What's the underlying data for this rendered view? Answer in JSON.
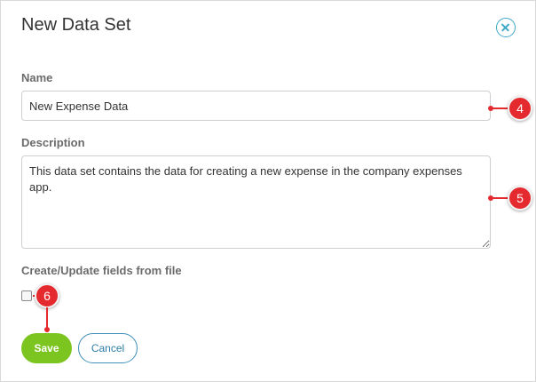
{
  "dialog": {
    "title": "New Data Set",
    "close_icon": "close-circle-icon"
  },
  "form": {
    "name_label": "Name",
    "name_value": "New Expense Data",
    "description_label": "Description",
    "description_value": "This data set contains the data for creating a new expense in the company expenses app.",
    "file_label": "Create/Update fields from file",
    "file_checked": false
  },
  "buttons": {
    "save_label": "Save",
    "cancel_label": "Cancel"
  },
  "markers": {
    "name_marker": "4",
    "description_marker": "5",
    "checkbox_marker": "6"
  },
  "colors": {
    "accent": "#3fa7c7",
    "save": "#7cc520",
    "marker": "#e42a2e"
  }
}
